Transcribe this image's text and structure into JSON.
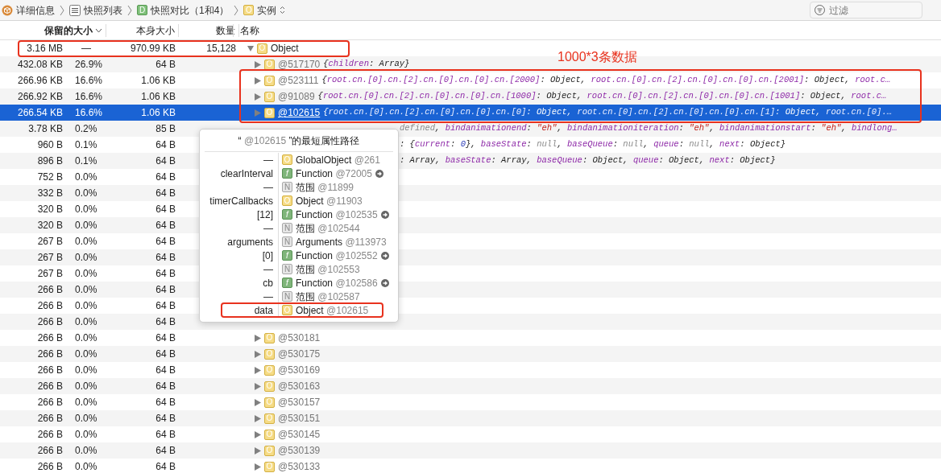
{
  "breadcrumbs": [
    {
      "label": "详细信息"
    },
    {
      "label": "快照列表"
    },
    {
      "badge": "D",
      "label": "快照对比（1和4）"
    },
    {
      "badge": "O",
      "label": "实例",
      "menu": true
    }
  ],
  "filter": {
    "placeholder": "过滤"
  },
  "columns": [
    {
      "label": "保留的大小",
      "sorted": true
    },
    {
      "label": "本身大小",
      "sorted": false
    },
    {
      "label": "数量",
      "sorted": false
    },
    {
      "label": "名称",
      "sorted": false
    }
  ],
  "summary": {
    "retained": "3.16 MB",
    "percent": "—",
    "self": "970.99 KB",
    "count": "15,128",
    "badge": "O",
    "name": "Object",
    "expanded": true
  },
  "rows": [
    {
      "retained": "432.08 KB",
      "percent": "26.9%",
      "self": "64 B",
      "selected": false,
      "badge": "O",
      "id": "@517170",
      "preview": [
        {
          "kind": "punct",
          "text": "{"
        },
        {
          "kind": "key",
          "text": "children"
        },
        {
          "kind": "punct",
          "text": ": "
        },
        {
          "kind": "type",
          "text": "Array"
        },
        {
          "kind": "punct",
          "text": "}"
        }
      ]
    },
    {
      "retained": "266.96 KB",
      "percent": "16.6%",
      "self": "1.06 KB",
      "selected": false,
      "badge": "O",
      "id": "@523111",
      "preview": [
        {
          "kind": "punct",
          "text": "{"
        },
        {
          "kind": "key",
          "text": "root.cn.[0].cn.[2].cn.[0].cn.[0].cn.[2000]"
        },
        {
          "kind": "punct",
          "text": ": "
        },
        {
          "kind": "type",
          "text": "Object"
        },
        {
          "kind": "punct",
          "text": ", "
        },
        {
          "kind": "key",
          "text": "root.cn.[0].cn.[2].cn.[0].cn.[0].cn.[2001]"
        },
        {
          "kind": "punct",
          "text": ": "
        },
        {
          "kind": "type",
          "text": "Object"
        },
        {
          "kind": "punct",
          "text": ", "
        },
        {
          "kind": "key",
          "text": "root.c…"
        }
      ]
    },
    {
      "retained": "266.92 KB",
      "percent": "16.6%",
      "self": "1.06 KB",
      "selected": false,
      "badge": "O",
      "id": "@91089",
      "preview": [
        {
          "kind": "punct",
          "text": "{"
        },
        {
          "kind": "key",
          "text": "root.cn.[0].cn.[2].cn.[0].cn.[0].cn.[1000]"
        },
        {
          "kind": "punct",
          "text": ": "
        },
        {
          "kind": "type",
          "text": "Object"
        },
        {
          "kind": "punct",
          "text": ", "
        },
        {
          "kind": "key",
          "text": "root.cn.[0].cn.[2].cn.[0].cn.[0].cn.[1001]"
        },
        {
          "kind": "punct",
          "text": ": "
        },
        {
          "kind": "type",
          "text": "Object"
        },
        {
          "kind": "punct",
          "text": ", "
        },
        {
          "kind": "key",
          "text": "root.c…"
        }
      ]
    },
    {
      "retained": "266.54 KB",
      "percent": "16.6%",
      "self": "1.06 KB",
      "selected": true,
      "badge": "O",
      "id": "@102615",
      "preview": [
        {
          "kind": "punct",
          "text": "{"
        },
        {
          "kind": "key",
          "text": "root.cn.[0].cn.[2].cn.[0].cn.[0].cn.[0]"
        },
        {
          "kind": "punct",
          "text": ": "
        },
        {
          "kind": "type",
          "text": "Object"
        },
        {
          "kind": "punct",
          "text": ", "
        },
        {
          "kind": "key",
          "text": "root.cn.[0].cn.[2].cn.[0].cn.[0].cn.[1]"
        },
        {
          "kind": "punct",
          "text": ": "
        },
        {
          "kind": "type",
          "text": "Object"
        },
        {
          "kind": "punct",
          "text": ", "
        },
        {
          "kind": "key",
          "text": "root.cn.[0].…"
        }
      ]
    },
    {
      "retained": "3.78 KB",
      "percent": "0.2%",
      "self": "85 B",
      "selected": false,
      "tail": [
        {
          "kind": "keyword",
          "text": "defined"
        },
        {
          "kind": "punct",
          "text": ", "
        },
        {
          "kind": "key",
          "text": "bindanimationend"
        },
        {
          "kind": "punct",
          "text": ": "
        },
        {
          "kind": "string",
          "text": "\"eh\""
        },
        {
          "kind": "punct",
          "text": ", "
        },
        {
          "kind": "key",
          "text": "bindanimationiteration"
        },
        {
          "kind": "punct",
          "text": ": "
        },
        {
          "kind": "string",
          "text": "\"eh\""
        },
        {
          "kind": "punct",
          "text": ", "
        },
        {
          "kind": "key",
          "text": "bindanimationstart"
        },
        {
          "kind": "punct",
          "text": ": "
        },
        {
          "kind": "string",
          "text": "\"eh\""
        },
        {
          "kind": "punct",
          "text": ", "
        },
        {
          "kind": "key",
          "text": "bindlong…"
        }
      ]
    },
    {
      "retained": "960 B",
      "percent": "0.1%",
      "self": "64 B",
      "selected": false,
      "tail": [
        {
          "kind": "punct",
          "text": ": {"
        },
        {
          "kind": "key",
          "text": "current"
        },
        {
          "kind": "punct",
          "text": ": "
        },
        {
          "kind": "number",
          "text": "0"
        },
        {
          "kind": "punct",
          "text": "}, "
        },
        {
          "kind": "key",
          "text": "baseState"
        },
        {
          "kind": "punct",
          "text": ": "
        },
        {
          "kind": "keyword",
          "text": "null"
        },
        {
          "kind": "punct",
          "text": ", "
        },
        {
          "kind": "key",
          "text": "baseQueue"
        },
        {
          "kind": "punct",
          "text": ": "
        },
        {
          "kind": "keyword",
          "text": "null"
        },
        {
          "kind": "punct",
          "text": ", "
        },
        {
          "kind": "key",
          "text": "queue"
        },
        {
          "kind": "punct",
          "text": ": "
        },
        {
          "kind": "keyword",
          "text": "null"
        },
        {
          "kind": "punct",
          "text": ", "
        },
        {
          "kind": "key",
          "text": "next"
        },
        {
          "kind": "punct",
          "text": ": "
        },
        {
          "kind": "type",
          "text": "Object"
        },
        {
          "kind": "punct",
          "text": "}"
        }
      ]
    },
    {
      "retained": "896 B",
      "percent": "0.1%",
      "self": "64 B",
      "selected": false,
      "tail": [
        {
          "kind": "punct",
          "text": ": "
        },
        {
          "kind": "type",
          "text": "Array"
        },
        {
          "kind": "punct",
          "text": ", "
        },
        {
          "kind": "key",
          "text": "baseState"
        },
        {
          "kind": "punct",
          "text": ": "
        },
        {
          "kind": "type",
          "text": "Array"
        },
        {
          "kind": "punct",
          "text": ", "
        },
        {
          "kind": "key",
          "text": "baseQueue"
        },
        {
          "kind": "punct",
          "text": ": "
        },
        {
          "kind": "type",
          "text": "Object"
        },
        {
          "kind": "punct",
          "text": ", "
        },
        {
          "kind": "key",
          "text": "queue"
        },
        {
          "kind": "punct",
          "text": ": "
        },
        {
          "kind": "type",
          "text": "Object"
        },
        {
          "kind": "punct",
          "text": ", "
        },
        {
          "kind": "key",
          "text": "next"
        },
        {
          "kind": "punct",
          "text": ": "
        },
        {
          "kind": "type",
          "text": "Object"
        },
        {
          "kind": "punct",
          "text": "}"
        }
      ]
    },
    {
      "retained": "752 B",
      "percent": "0.0%",
      "self": "64 B",
      "selected": false
    },
    {
      "retained": "332 B",
      "percent": "0.0%",
      "self": "64 B",
      "selected": false
    },
    {
      "retained": "320 B",
      "percent": "0.0%",
      "self": "64 B",
      "selected": false
    },
    {
      "retained": "320 B",
      "percent": "0.0%",
      "self": "64 B",
      "selected": false
    },
    {
      "retained": "267 B",
      "percent": "0.0%",
      "self": "64 B",
      "selected": false
    },
    {
      "retained": "267 B",
      "percent": "0.0%",
      "self": "64 B",
      "selected": false
    },
    {
      "retained": "267 B",
      "percent": "0.0%",
      "self": "64 B",
      "selected": false
    },
    {
      "retained": "266 B",
      "percent": "0.0%",
      "self": "64 B",
      "selected": false
    },
    {
      "retained": "266 B",
      "percent": "0.0%",
      "self": "64 B",
      "selected": false
    },
    {
      "retained": "266 B",
      "percent": "0.0%",
      "self": "64 B",
      "selected": false
    },
    {
      "retained": "266 B",
      "percent": "0.0%",
      "self": "64 B",
      "selected": false,
      "badge": "O",
      "id": "@530181"
    },
    {
      "retained": "266 B",
      "percent": "0.0%",
      "self": "64 B",
      "selected": false,
      "badge": "O",
      "id": "@530175"
    },
    {
      "retained": "266 B",
      "percent": "0.0%",
      "self": "64 B",
      "selected": false,
      "badge": "O",
      "id": "@530169"
    },
    {
      "retained": "266 B",
      "percent": "0.0%",
      "self": "64 B",
      "selected": false,
      "badge": "O",
      "id": "@530163"
    },
    {
      "retained": "266 B",
      "percent": "0.0%",
      "self": "64 B",
      "selected": false,
      "badge": "O",
      "id": "@530157"
    },
    {
      "retained": "266 B",
      "percent": "0.0%",
      "self": "64 B",
      "selected": false,
      "badge": "O",
      "id": "@530151"
    },
    {
      "retained": "266 B",
      "percent": "0.0%",
      "self": "64 B",
      "selected": false,
      "badge": "O",
      "id": "@530145"
    },
    {
      "retained": "266 B",
      "percent": "0.0%",
      "self": "64 B",
      "selected": false,
      "badge": "O",
      "id": "@530139"
    },
    {
      "retained": "266 B",
      "percent": "0.0%",
      "self": "64 B",
      "selected": false,
      "badge": "O",
      "id": "@530133"
    }
  ],
  "path_popover": {
    "title_open": "“ ",
    "title_id": "@102615",
    "title_close": " ”的最短属性路径",
    "rows": [
      {
        "label": "—",
        "badge": "O",
        "type": "GlobalObject",
        "id": "@261",
        "link": false
      },
      {
        "label": "clearInterval",
        "badge": "f",
        "type": "Function",
        "id": "@72005",
        "link": true
      },
      {
        "label": "—",
        "badge": "N",
        "type": "范围",
        "id": "@11899",
        "link": false
      },
      {
        "label": "timerCallbacks",
        "badge": "O",
        "type": "Object",
        "id": "@11903",
        "link": false
      },
      {
        "label": "[12]",
        "badge": "f",
        "type": "Function",
        "id": "@102535",
        "link": true
      },
      {
        "label": "—",
        "badge": "N",
        "type": "范围",
        "id": "@102544",
        "link": false
      },
      {
        "label": "arguments",
        "badge": "N",
        "type": "Arguments",
        "id": "@113973",
        "link": false
      },
      {
        "label": "[0]",
        "badge": "f",
        "type": "Function",
        "id": "@102552",
        "link": true
      },
      {
        "label": "—",
        "badge": "N",
        "type": "范围",
        "id": "@102553",
        "link": false
      },
      {
        "label": "cb",
        "badge": "f",
        "type": "Function",
        "id": "@102586",
        "link": true
      },
      {
        "label": "—",
        "badge": "N",
        "type": "范围",
        "id": "@102587",
        "link": false
      },
      {
        "label": "data",
        "badge": "O",
        "type": "Object",
        "id": "@102615",
        "link": false
      }
    ]
  },
  "annotation": {
    "text": "1000*3条数据"
  }
}
